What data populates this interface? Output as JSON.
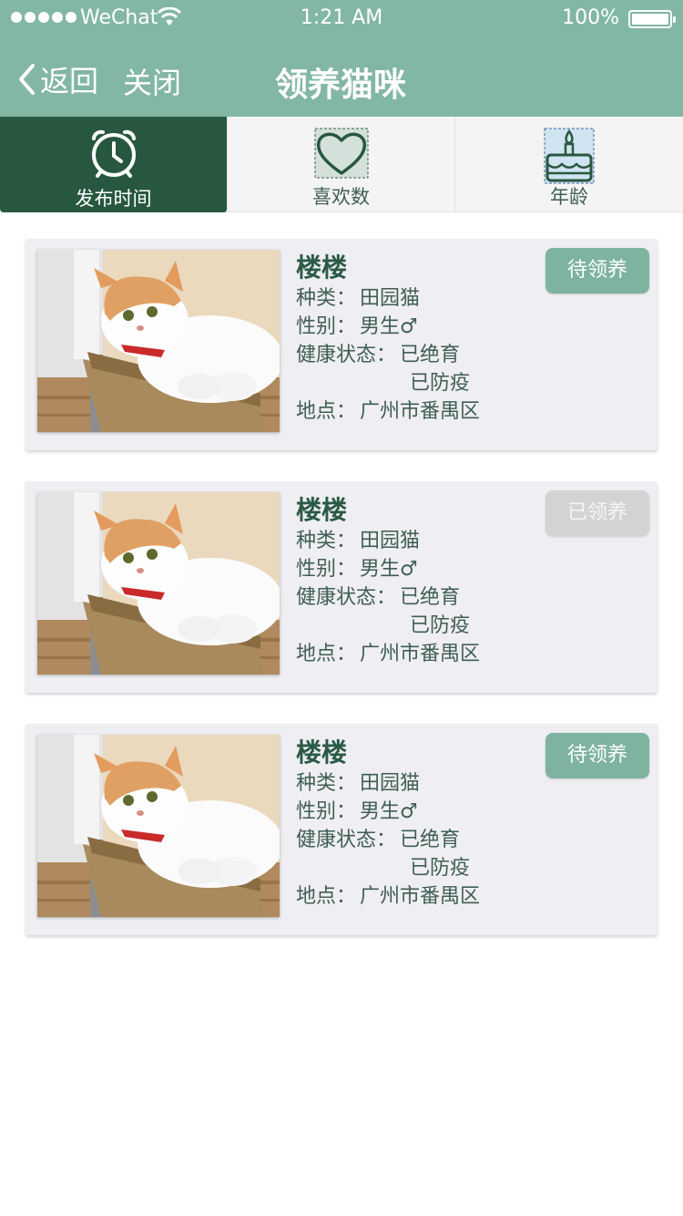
{
  "status_bar": {
    "carrier": "WeChat",
    "time": "1:21 AM",
    "battery": "100%"
  },
  "nav": {
    "back_label": "返回",
    "close_label": "关闭",
    "title": "领养猫咪"
  },
  "tabs": [
    {
      "label": "发布时间",
      "icon": "alarm-clock-icon",
      "active": true
    },
    {
      "label": "喜欢数",
      "icon": "heart-icon",
      "active": false
    },
    {
      "label": "年龄",
      "icon": "birthday-cake-icon",
      "active": false
    }
  ],
  "cards": [
    {
      "name": "楼楼",
      "breed_key": "种类：",
      "breed": "田园猫",
      "gender_key": "性别：",
      "gender": "男生♂",
      "health_key": "健康状态：",
      "health_1": "已绝育",
      "health_2": "已防疫",
      "location_key": "地点：",
      "location": "广州市番禺区",
      "status": "待领养"
    },
    {
      "name": "楼楼",
      "breed_key": "种类：",
      "breed": "田园猫",
      "gender_key": "性别：",
      "gender": "男生♂",
      "health_key": "健康状态：",
      "health_1": "已绝育",
      "health_2": "已防疫",
      "location_key": "地点：",
      "location": "广州市番禺区",
      "status": "已领养"
    },
    {
      "name": "楼楼",
      "breed_key": "种类：",
      "breed": "田园猫",
      "gender_key": "性别：",
      "gender": "男生♂",
      "health_key": "健康状态：",
      "health_1": "已绝育",
      "health_2": "已防疫",
      "location_key": "地点：",
      "location": "广州市番禺区",
      "status": "待领养"
    }
  ],
  "colors": {
    "header": "#82b7a3",
    "active_tab": "#27583f",
    "badge_available": "#7db39f",
    "badge_adopted": "#d3d3d3"
  }
}
